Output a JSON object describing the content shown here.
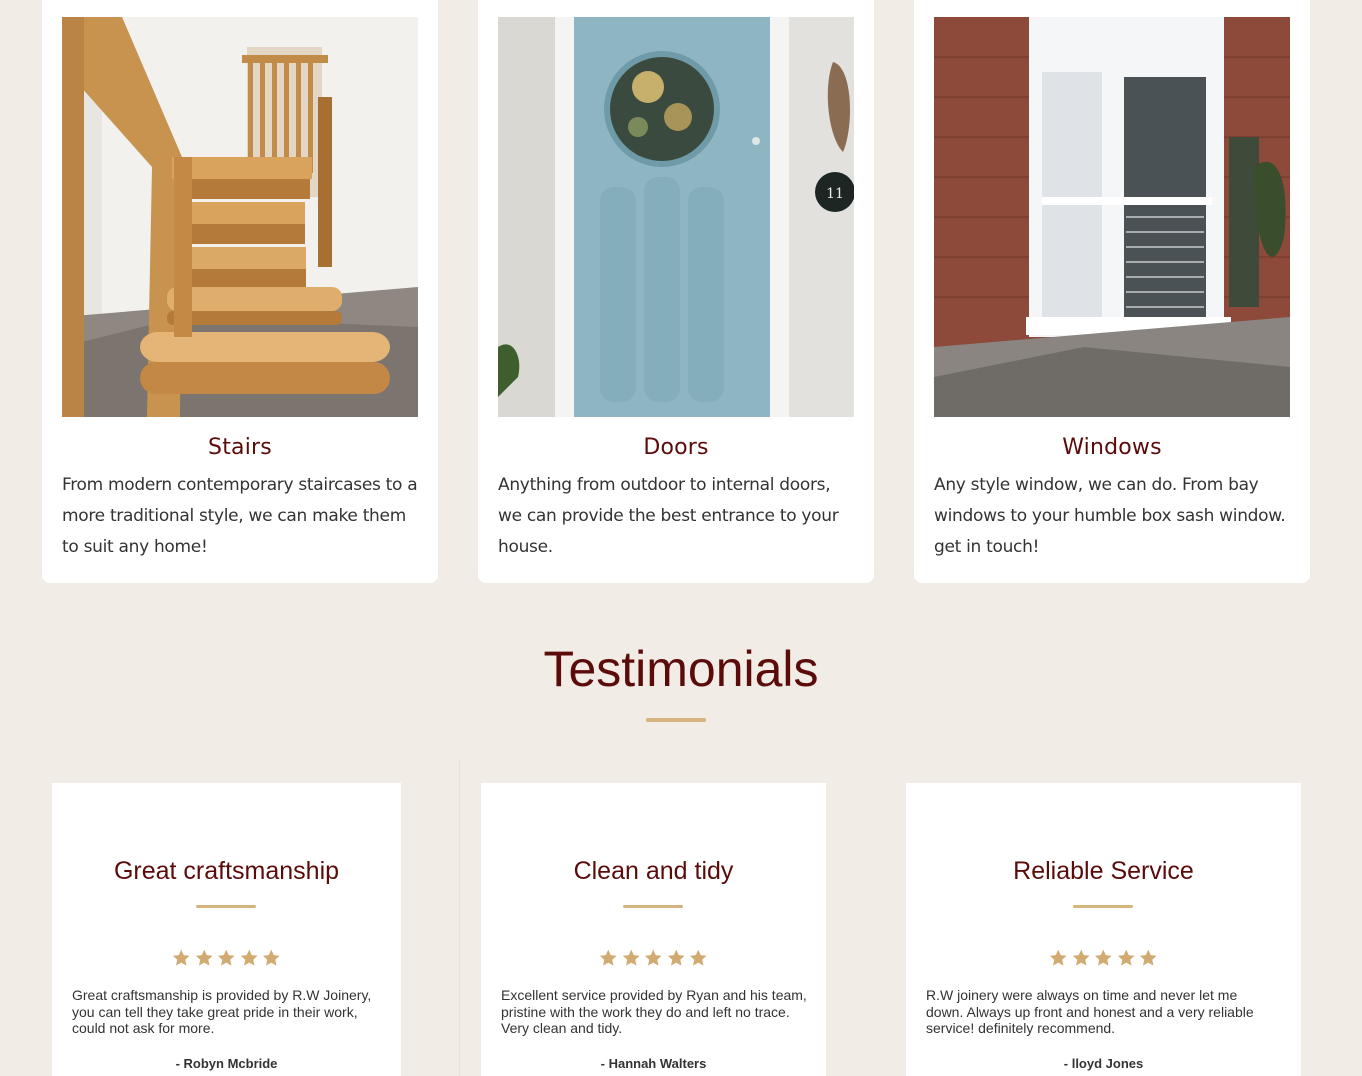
{
  "services": [
    {
      "title": "Stairs",
      "description": "From modern contemporary staircases to a more traditional style, we can make them to suit any home!",
      "image_icon": "staircase-photo"
    },
    {
      "title": "Doors",
      "description": "Anything from outdoor to internal doors, we can provide the best entrance to your house.",
      "image_icon": "door-photo"
    },
    {
      "title": "Windows",
      "description": "Any style window, we can do. From bay windows to your humble box sash window. get in touch!",
      "image_icon": "bay-window-photo"
    }
  ],
  "testimonials": {
    "heading": "Testimonials",
    "items": [
      {
        "title": "Great craftsmanship",
        "rating": 5,
        "text": "Great craftsmanship is provided by R.W Joinery, you can tell they take great pride in their work, could not ask for more.",
        "author": "- Robyn Mcbride"
      },
      {
        "title": "Clean and tidy",
        "rating": 5,
        "text": "Excellent service provided by Ryan and his team, pristine with the work they do and left no trace. Very clean and tidy.",
        "author": "- Hannah Walters"
      },
      {
        "title": "Reliable Service",
        "rating": 5,
        "text": "R.W joinery were always on time and never let me down. Always up front and honest and a very reliable service! definitely recommend.",
        "author": "- lloyd Jones"
      }
    ]
  },
  "colors": {
    "background": "#f1ece5",
    "heading": "#5c0b0b",
    "accent_gold": "#d6b47e",
    "star": "#d2ab72",
    "text": "#333333"
  }
}
